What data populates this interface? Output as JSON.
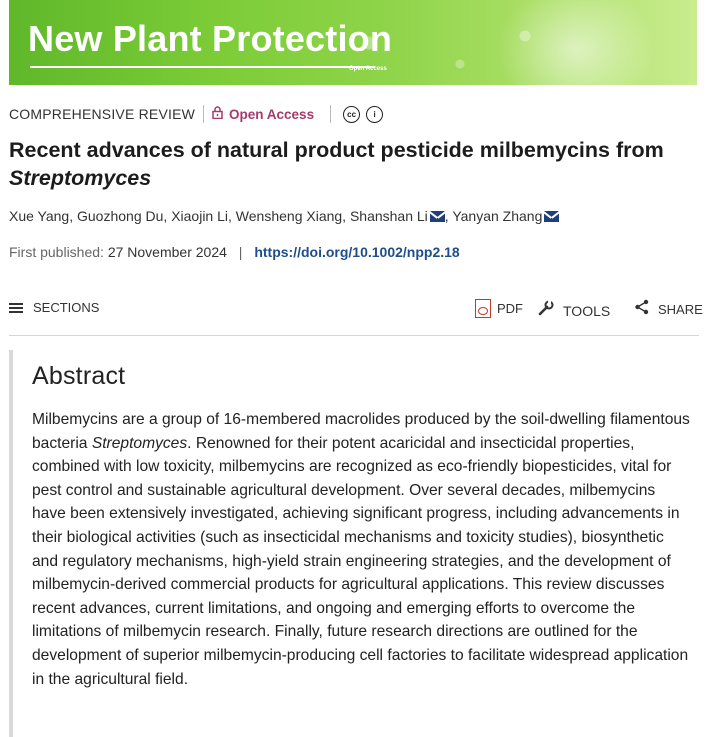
{
  "banner": {
    "title": "New Plant Protection",
    "open_access": "Open Access"
  },
  "meta": {
    "article_type": "COMPREHENSIVE REVIEW",
    "open_access_label": "Open Access",
    "lock_icon": "lock-icon",
    "license_icons": [
      "cc-icon",
      "attribution-icon"
    ],
    "cc_glyph": "cc",
    "by_glyph": "i"
  },
  "article": {
    "title_main": "Recent advances of natural product pesticide milbemycins from ",
    "title_italic": "Streptomyces"
  },
  "authors": [
    {
      "name": "Xue Yang",
      "email": false
    },
    {
      "name": "Guozhong Du",
      "email": false
    },
    {
      "name": "Xiaojin Li",
      "email": false
    },
    {
      "name": "Wensheng Xiang",
      "email": false
    },
    {
      "name": "Shanshan Li",
      "email": true
    },
    {
      "name": "Yanyan Zhang",
      "email": true
    }
  ],
  "published": {
    "label": "First published:",
    "date": "27 November 2024",
    "separator": "|",
    "doi": "https://doi.org/10.1002/npp2.18"
  },
  "toolbar": {
    "sections": "SECTIONS",
    "pdf": "PDF",
    "tools": "TOOLS",
    "share": "SHARE"
  },
  "abstract": {
    "heading": "Abstract",
    "text_before_italic": "Milbemycins are a group of 16-membered macrolides produced by the soil-dwelling filamentous bacteria ",
    "italic": "Streptomyces",
    "text_after_italic": ". Renowned for their potent acaricidal and insecticidal properties, combined with low toxicity, milbemycins are recognized as eco-friendly biopesticides, vital for pest control and sustainable agricultural development. Over several decades, milbemycins have been extensively investigated, achieving significant progress, including advancements in their biological activities (such as insecticidal mechanisms and toxicity studies), biosynthetic and regulatory mechanisms, high-yield strain engineering strategies, and the development of milbemycin-derived commercial products for agricultural applications. This review discusses recent advances, current limitations, and ongoing and emerging efforts to overcome the limitations of milbemycin research. Finally, future research directions are outlined for the development of superior milbemycin-producing cell factories to facilitate widespread application in the agricultural field."
  },
  "colors": {
    "banner_green": "#7ccc37",
    "open_access_magenta": "#a63a6e",
    "doi_blue": "#1f4e8c",
    "mail_icon": "#1f3f7a",
    "pdf_red": "#c0392b"
  }
}
